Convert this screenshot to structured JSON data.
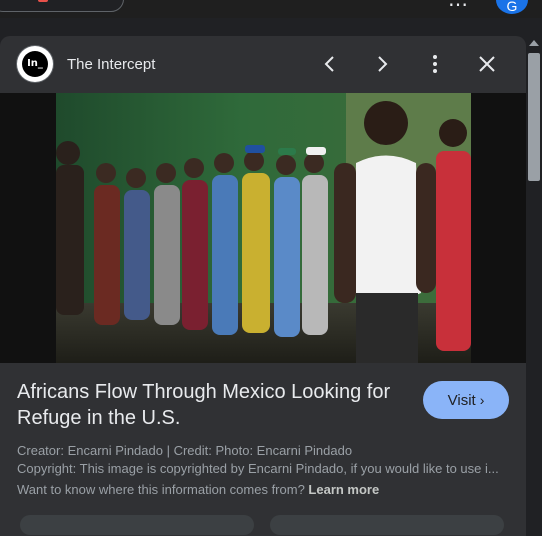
{
  "topbar": {
    "more_icon": "⋯",
    "avatar_letter": "G"
  },
  "header": {
    "logo_text": "In_",
    "source_name": "The Intercept",
    "icons": [
      "chevron-left-icon",
      "chevron-right-icon",
      "more-vert-icon",
      "close-icon"
    ]
  },
  "result": {
    "title": "Africans Flow Through Mexico Looking for Refuge in the U.S.",
    "visit_label": "Visit",
    "creator_line": "Creator: Encarni Pindado | Credit: Photo: Encarni Pindado",
    "copyright_line": "Copyright: This image is copyrighted by Encarni Pindado, if you would like to use i...",
    "info_question": "Want to know where this information comes from?",
    "learn_more": "Learn more"
  },
  "colors": {
    "accent": "#8ab4f8",
    "panel": "#303134",
    "background": "#202124"
  }
}
